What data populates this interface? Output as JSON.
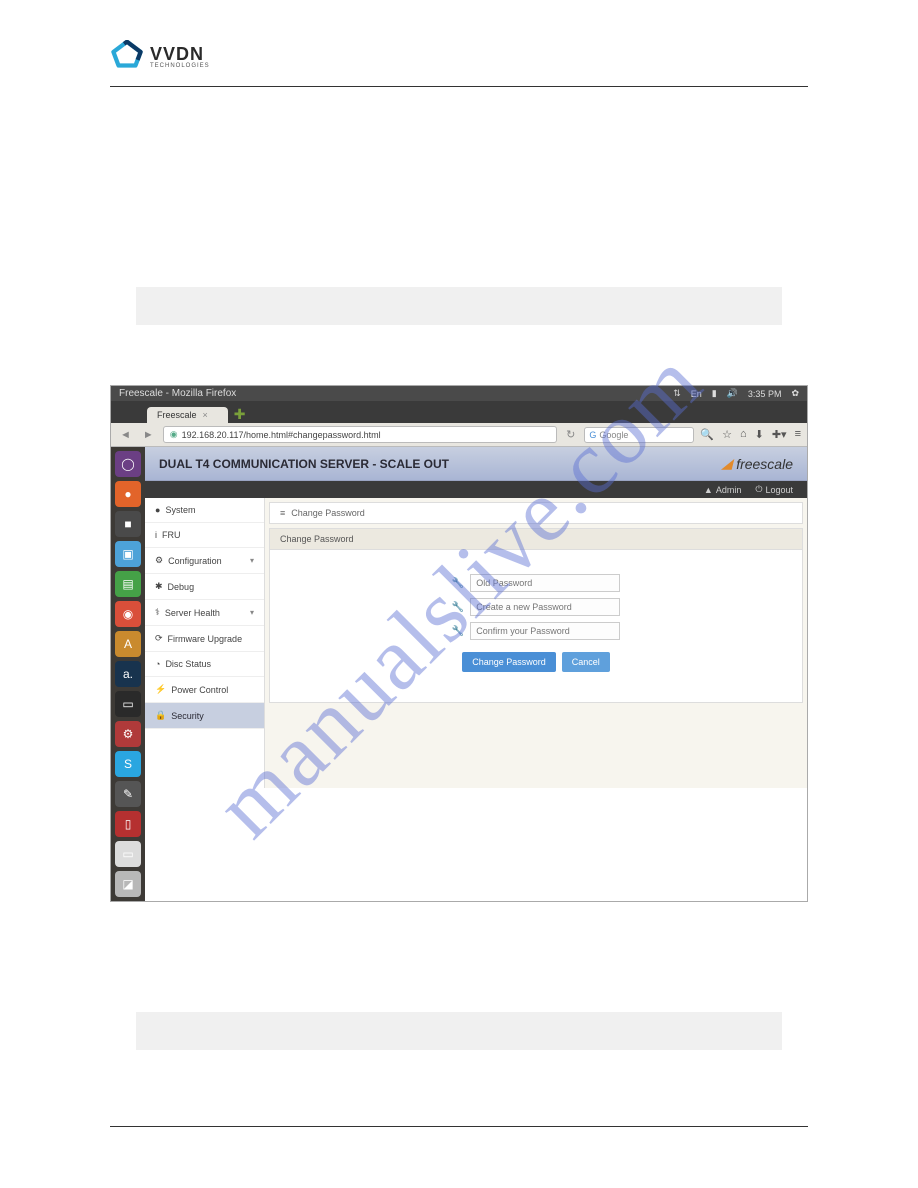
{
  "logo": {
    "name": "VVDN",
    "sub": "TECHNOLOGIES"
  },
  "watermark": "manualslive.com",
  "window": {
    "title": "Freescale - Mozilla Firefox",
    "tray": {
      "lang": "En",
      "time": "3:35 PM"
    }
  },
  "tab": {
    "label": "Freescale"
  },
  "url": "192.168.20.117/home.html#changepassword.html",
  "search_placeholder": "Google",
  "banner_title": "DUAL T4 COMMUNICATION SERVER - SCALE OUT",
  "brand": "freescale",
  "userbar": {
    "admin": "Admin",
    "logout": "Logout"
  },
  "sidebar": {
    "items": [
      {
        "icon": "●",
        "label": "System"
      },
      {
        "icon": "i",
        "label": "FRU"
      },
      {
        "icon": "⚙",
        "label": "Configuration",
        "expand": true
      },
      {
        "icon": "✱",
        "label": "Debug"
      },
      {
        "icon": "⚕",
        "label": "Server Health",
        "expand": true
      },
      {
        "icon": "⟳",
        "label": "Firmware Upgrade"
      },
      {
        "icon": "◔",
        "label": "Disc Status"
      },
      {
        "icon": "⚡",
        "label": "Power Control"
      },
      {
        "icon": "🔒",
        "label": "Security",
        "active": true
      }
    ]
  },
  "main": {
    "breadcrumb": "Change Password",
    "panel_title": "Change Password",
    "fields": {
      "old": "Old Password",
      "new": "Create a new Password",
      "confirm": "Confirm your Password"
    },
    "buttons": {
      "change": "Change Password",
      "cancel": "Cancel"
    }
  },
  "launcher_colors": [
    "#6b3f84",
    "#e2642a",
    "#4a4a4a",
    "#4da2d8",
    "#45a147",
    "#d94f3a",
    "#c98a2e",
    "#18334e",
    "#2a2a2a",
    "#b03a3a",
    "#2aa6e0",
    "#555555",
    "#b53030",
    "#dcdcdc",
    "#b8b8b8"
  ],
  "launcher_glyphs": [
    "◯",
    "●",
    "■",
    "▣",
    "▤",
    "◉",
    "A",
    "a.",
    "▭",
    "⚙",
    "S",
    "✎",
    "▯",
    "▭",
    "◪"
  ]
}
